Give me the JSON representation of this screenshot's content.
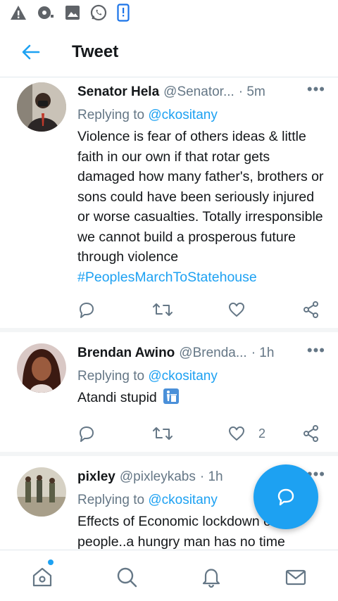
{
  "status_bar": {
    "icons": [
      "warning-icon",
      "cast-icon",
      "image-icon",
      "whatsapp-icon",
      "phone-icon"
    ]
  },
  "header": {
    "back_icon": "arrow-left-icon",
    "title": "Tweet"
  },
  "tweets": [
    {
      "name": "Senator Hela",
      "handle": "@Senator...",
      "time": "· 5m",
      "more": "•••",
      "replying_label": "Replying to",
      "replying_to": "@ckositany",
      "text": "Violence is fear of others ideas & little faith in our own if that rotar gets damaged how many father's, brothers or sons could have been seriously injured or worse casualties. Totally irresponsible we cannot build a prosperous future through violence",
      "hashtag": "#PeoplesMarchToStatehouse",
      "like_count": ""
    },
    {
      "name": "Brendan Awino",
      "handle": "@Brenda...",
      "time": "· 1h",
      "more": "•••",
      "replying_label": "Replying to",
      "replying_to": "@ckositany",
      "text": "Atandi stupid",
      "emoji": "person-bin-emoji",
      "like_count": "2"
    },
    {
      "name": "pixley",
      "handle": "@pixleykabs",
      "time": "· 1h",
      "more": "•••",
      "replying_label": "Replying to",
      "replying_to": "@ckositany",
      "text": "Effects of Economic lockdown on people..a hungry man has no time"
    }
  ],
  "fab": {
    "icon": "compose-reply-icon"
  },
  "bottom_nav": {
    "items": [
      "home-icon",
      "search-icon",
      "notifications-icon",
      "messages-icon"
    ]
  },
  "colors": {
    "accent": "#1da1f2",
    "text": "#14171a",
    "secondary": "#657786",
    "divider": "#e1e8ed"
  }
}
